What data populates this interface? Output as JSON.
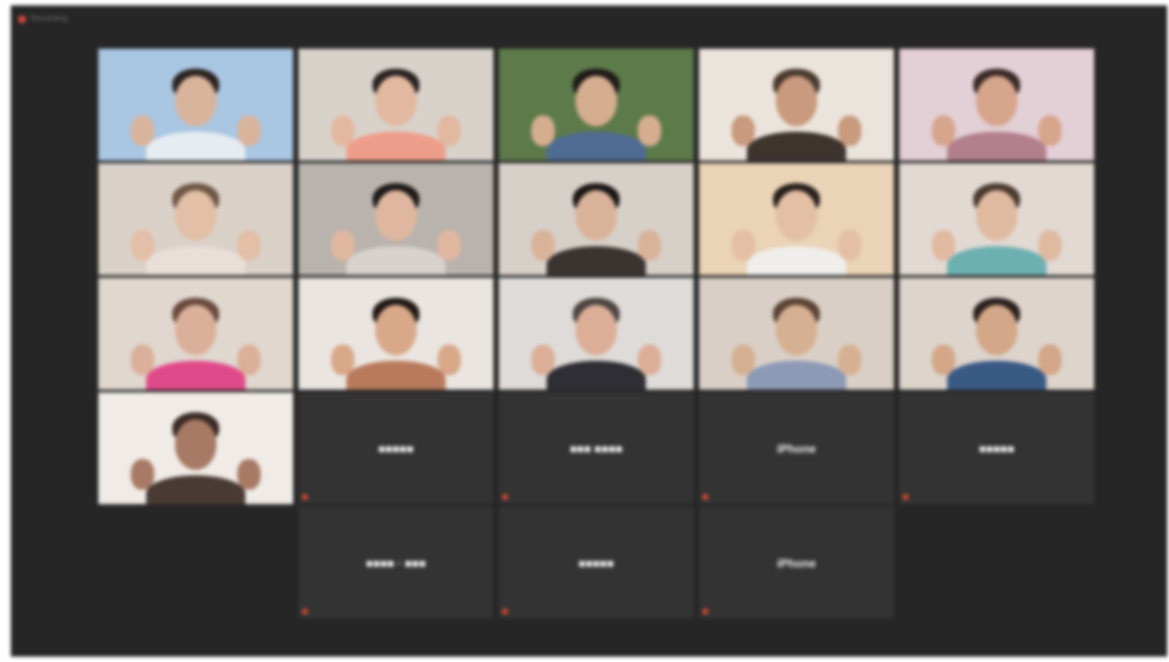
{
  "window": {
    "recording_icon": "record-icon",
    "recording_label": "Recording"
  },
  "colors": {
    "background": "#262626",
    "tile_off": "#333333",
    "active_speaker_border": "#9ab860",
    "muted_mic": "#d24a30"
  },
  "participants": [
    {
      "type": "video",
      "bg": "#a9c6e2",
      "skin": "#d9b49c",
      "hair": "#2b2320",
      "shirt": "#e6ecf2",
      "active": false
    },
    {
      "type": "video",
      "bg": "#d8d2cb",
      "skin": "#e3b8a0",
      "hair": "#2a2220",
      "shirt": "#ee9d8a",
      "active": true
    },
    {
      "type": "video",
      "bg": "#5d7a4a",
      "skin": "#d5ad8f",
      "hair": "#1f1a18",
      "shirt": "#4f6b94",
      "active": false
    },
    {
      "type": "video",
      "bg": "#ebe4dc",
      "skin": "#c99a7e",
      "hair": "#4a3a2e",
      "shirt": "#3e342e",
      "active": false
    },
    {
      "type": "video",
      "bg": "#e3cfd6",
      "skin": "#d6a58c",
      "hair": "#3a2a26",
      "shirt": "#b27f8c",
      "active": false
    },
    {
      "type": "video",
      "bg": "#dad1c9",
      "skin": "#e2bfa6",
      "hair": "#6e5646",
      "shirt": "#e8dfd8",
      "active": false
    },
    {
      "type": "video",
      "bg": "#b9b3ad",
      "skin": "#dfb7a0",
      "hair": "#1e1a18",
      "shirt": "#d7d2cc",
      "active": false
    },
    {
      "type": "video",
      "bg": "#d7d0c8",
      "skin": "#d9b29a",
      "hair": "#1d1816",
      "shirt": "#3a3430",
      "active": false
    },
    {
      "type": "video",
      "bg": "#ead3b6",
      "skin": "#e3bfa5",
      "hair": "#2a201c",
      "shirt": "#f0eeea",
      "active": false
    },
    {
      "type": "video",
      "bg": "#e2d9d2",
      "skin": "#e0b9a1",
      "hair": "#4a3a30",
      "shirt": "#6cb0b1",
      "active": false
    },
    {
      "type": "video",
      "bg": "#e0d7cf",
      "skin": "#dbb09a",
      "hair": "#6a4a3e",
      "shirt": "#e04a8a",
      "active": false
    },
    {
      "type": "video",
      "bg": "#eae5e0",
      "skin": "#d8a888",
      "hair": "#221a16",
      "shirt": "#b97a5c",
      "active": false
    },
    {
      "type": "video",
      "bg": "#dedbd8",
      "skin": "#dcae98",
      "hair": "#4c4540",
      "shirt": "#2e2e34",
      "active": false
    },
    {
      "type": "video",
      "bg": "#d9cfc6",
      "skin": "#d6b092",
      "hair": "#5a4436",
      "shirt": "#8c9ab6",
      "active": false
    },
    {
      "type": "video",
      "bg": "#ddd4cb",
      "skin": "#d3a787",
      "hair": "#2b2220",
      "shirt": "#3a5a86",
      "active": false
    },
    {
      "type": "video",
      "bg": "#f0ebe6",
      "skin": "#a87a66",
      "hair": "#3a2a26",
      "shirt": "#4a3a34",
      "active": false
    },
    {
      "type": "name",
      "name": "■■■■■"
    },
    {
      "type": "name",
      "name": "■■■ ■■■■"
    },
    {
      "type": "name",
      "name": "iPhone"
    },
    {
      "type": "name",
      "name": "■■■■■"
    },
    {
      "type": "name",
      "name": "■■■■ · ■■■"
    },
    {
      "type": "name",
      "name": "■■■■■"
    },
    {
      "type": "name",
      "name": "iPhone"
    }
  ]
}
